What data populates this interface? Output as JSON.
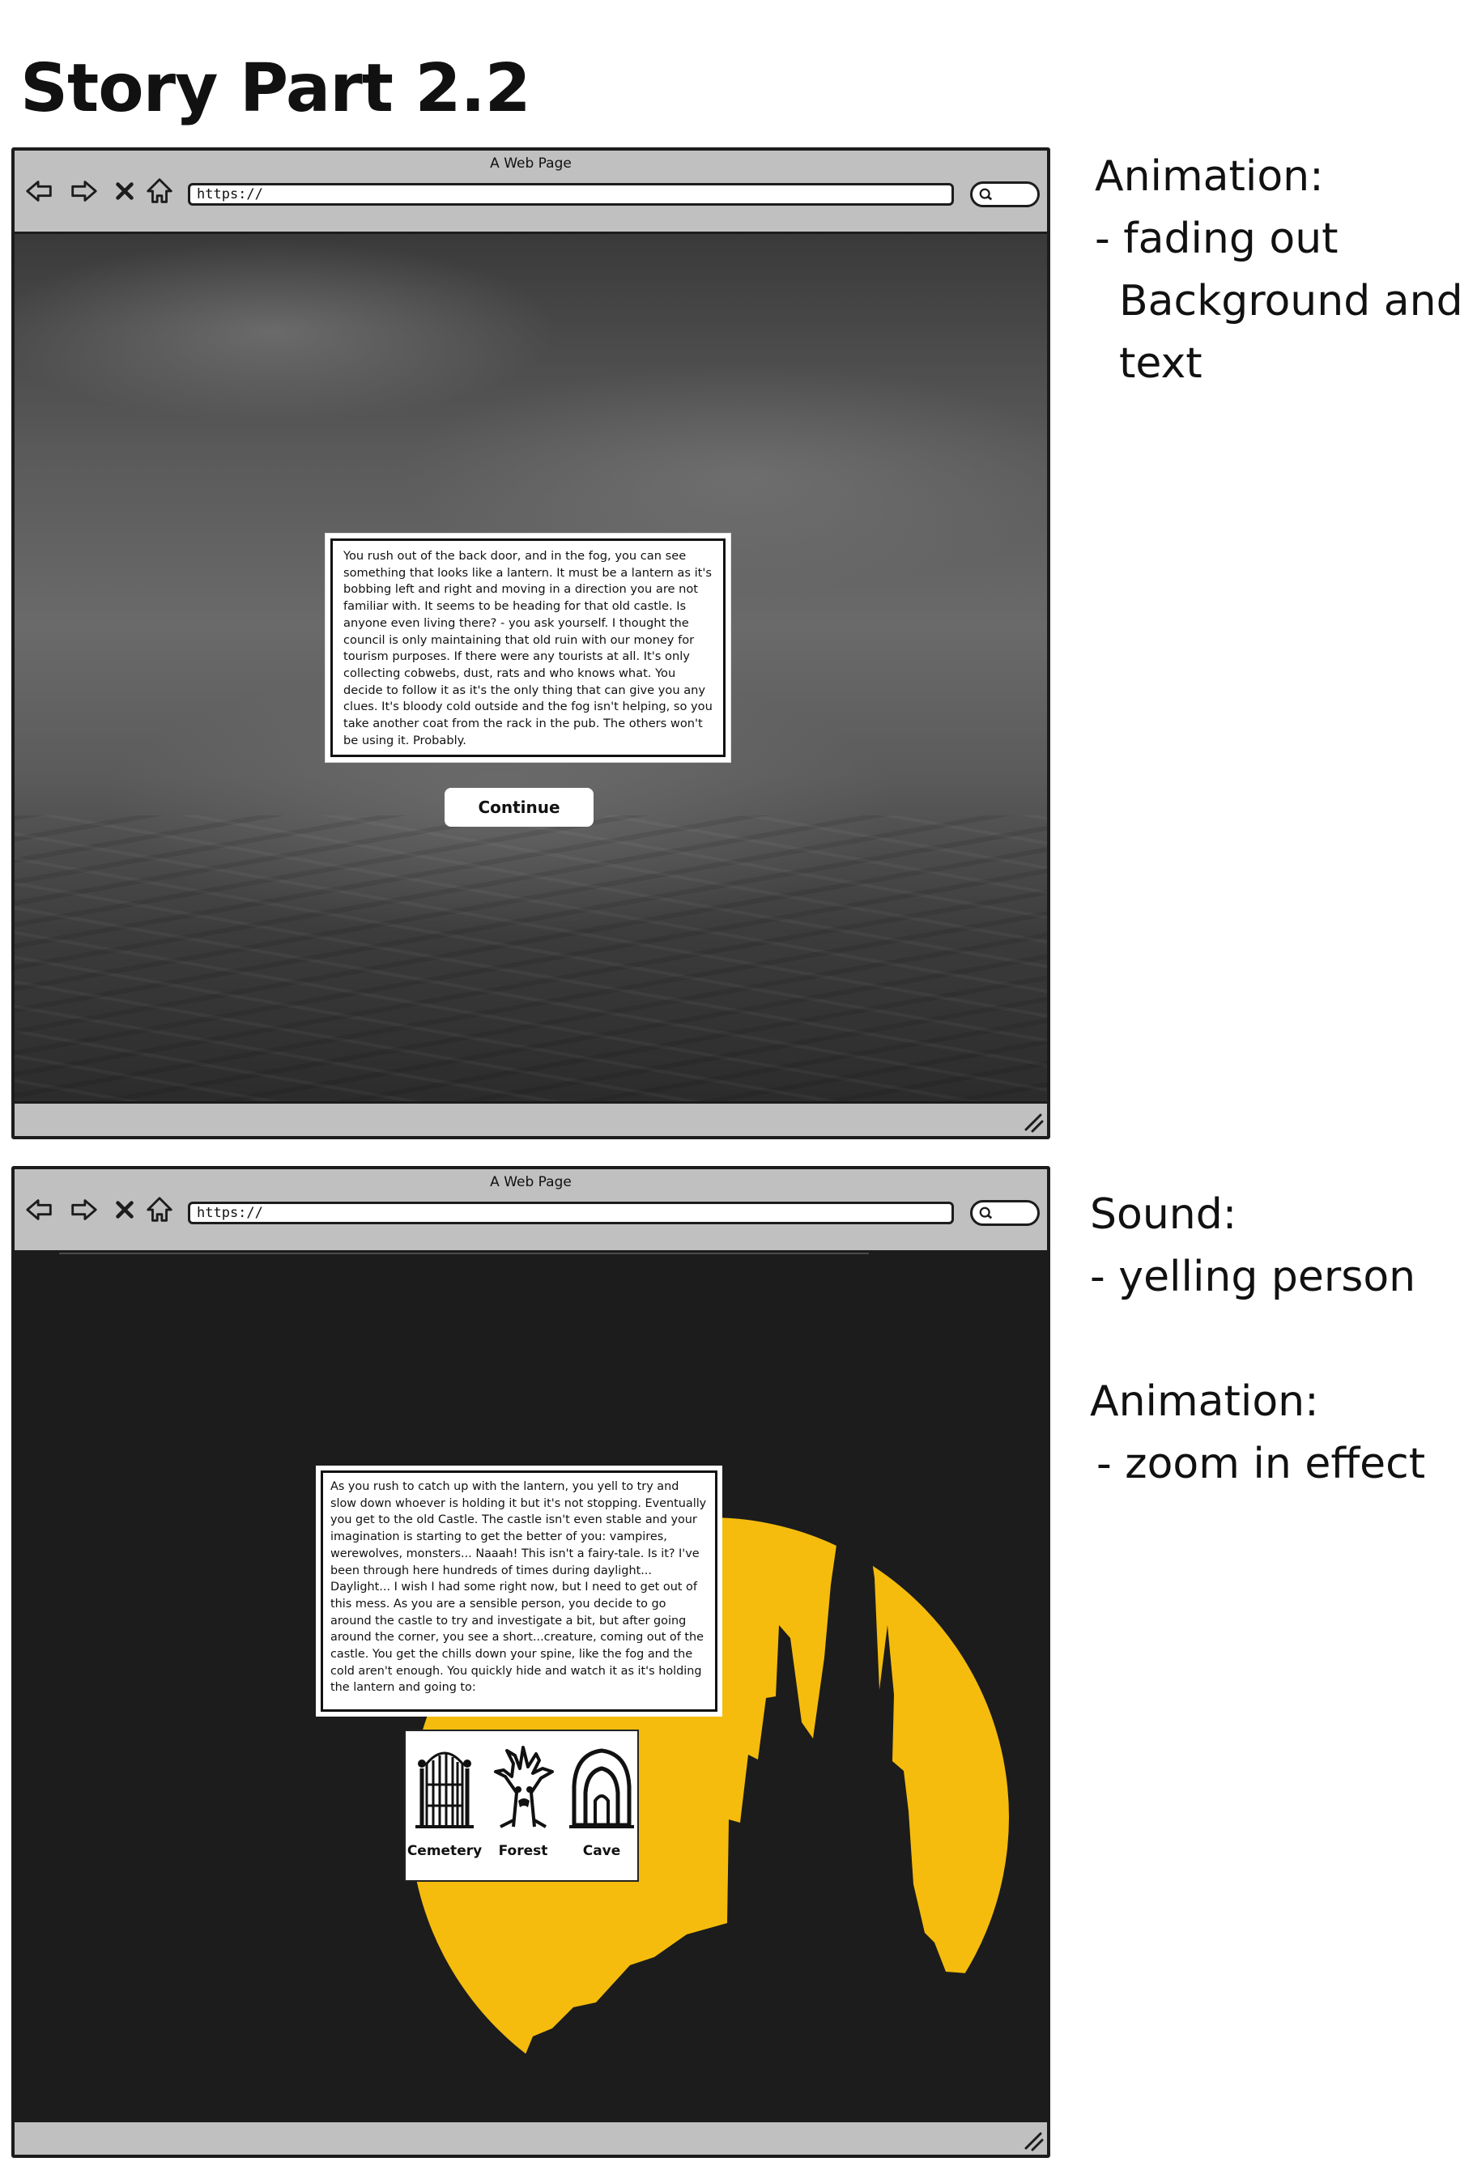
{
  "page": {
    "title": "Story Part 2.2"
  },
  "browser": {
    "window_title": "A Web Page",
    "url": "https://"
  },
  "panel1": {
    "story_text": "You rush out of the back door, and in the fog, you can see something that looks like a lantern. It must be a lantern as it's bobbing left and right and moving in a direction you are not familiar with. It seems to be heading for that old castle. Is anyone even living there? - you ask yourself. I thought the council is only maintaining that old ruin with our money for tourism purposes. If there were any tourists at all. It's only collecting cobwebs, dust, rats and who knows what. You decide to follow it as it's the only thing that can give you any clues. It's bloody cold outside and the fog isn't helping, so you take another coat from the rack in the pub. The others won't be using it. Probably.",
    "continue_label": "Continue"
  },
  "panel2": {
    "story_text": "As you rush to catch up with the lantern, you yell to try and slow down whoever is holding it but it's not stopping. Eventually you get to the old Castle. The castle isn't even stable and your imagination is starting to get the better of you: vampires, werewolves, monsters... Naaah! This isn't a fairy-tale. Is it? I've been through here hundreds of times during daylight... Daylight... I wish I had some right now, but I need to get out of this mess. As you are a sensible person, you decide to go around the castle to try and investigate a bit, but after going around the corner, you see a short...creature, coming out of the castle. You get the chills down your spine, like the fog and the cold aren't enough. You quickly hide and watch it as it's holding the lantern and going to:",
    "choices": [
      {
        "label": "Cemetery",
        "icon": "cemetery-gate-icon"
      },
      {
        "label": "Forest",
        "icon": "spooky-tree-icon"
      },
      {
        "label": "Cave",
        "icon": "cave-icon"
      }
    ]
  },
  "notes": {
    "note1": {
      "heading": "Animation:",
      "line1": "- fading out",
      "line2": "Background and",
      "line3": "text"
    },
    "note2": {
      "heading": "Sound:",
      "line1": "- yelling person",
      "heading2": "Animation:",
      "line2": "- zoom in effect"
    }
  },
  "colors": {
    "moon": "#f5bc0d",
    "night": "#1c1c1c",
    "browser_chrome": "#c0c0c0"
  },
  "icons": [
    "back-arrow-icon",
    "forward-arrow-icon",
    "close-icon",
    "home-icon",
    "search-icon",
    "resize-grip-icon"
  ]
}
